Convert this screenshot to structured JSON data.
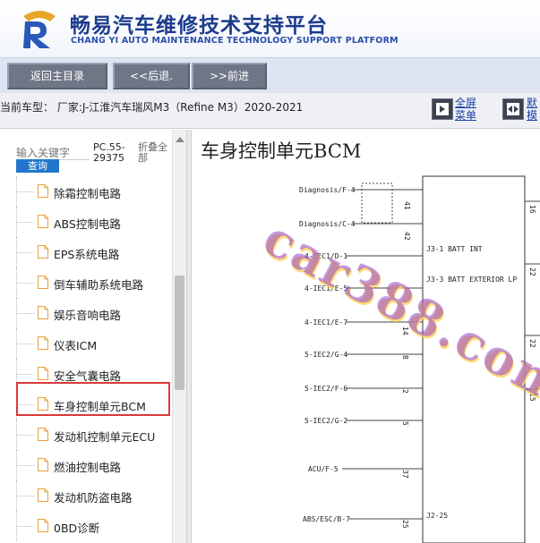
{
  "header": {
    "brand_cn": "畅易汽车维修技术支持平台",
    "brand_en": "CHANG YI AUTO MAINTENANCE TECHNOLOGY SUPPORT PLATFORM"
  },
  "toolbar": {
    "home_label": "返回主目录",
    "back_label": "<<后退.",
    "forward_label": ">>前进"
  },
  "model_bar": {
    "text": "当前车型：  厂家:J-江淮汽车瑞风M3（Refine M3）2020-2021",
    "fullscreen_label": "全屏\n菜单",
    "default_label": "默\n模"
  },
  "search": {
    "placeholder": "输入关键字",
    "button_label": "查询",
    "pc_code": "PC.55-29375",
    "fold_all": "折叠全部"
  },
  "tree": {
    "items": [
      {
        "label": "除霜控制电路"
      },
      {
        "label": "ABS控制电路"
      },
      {
        "label": "EPS系统电路"
      },
      {
        "label": "倒车辅助系统电路"
      },
      {
        "label": "娱乐音响电路"
      },
      {
        "label": "仪表ICM"
      },
      {
        "label": "安全气囊电路"
      },
      {
        "label": "车身控制单元BCM"
      },
      {
        "label": "发动机控制单元ECU"
      },
      {
        "label": "燃油控制电路"
      },
      {
        "label": "发动机防盗电路"
      },
      {
        "label": "0BD诊断"
      }
    ],
    "selected_index": 7
  },
  "content": {
    "title": "车身控制单元BCM",
    "watermark": "car388.com",
    "diagram": {
      "left_labels": [
        {
          "text": "Diagnosis/F-4",
          "pin": "41"
        },
        {
          "text": "Diagnosis/C-4",
          "pin": "42"
        },
        {
          "text": "4-IEC1/D-1",
          "pin": ""
        },
        {
          "text": "4-IEC1/E-5",
          "pin": ""
        },
        {
          "text": "4-IEC1/E-7",
          "pin": "14"
        },
        {
          "text": "5-IEC2/G-4",
          "pin": "8"
        },
        {
          "text": "5-IEC2/F-6",
          "pin": "2"
        },
        {
          "text": "5-IEC2/G-2",
          "pin": "5"
        },
        {
          "text": "ACU/F-5",
          "pin": "37"
        },
        {
          "text": "ABS/ESC/B-7",
          "pin": "25"
        }
      ],
      "inner_labels": [
        {
          "text": "J3-1 BATT INT"
        },
        {
          "text": "J3-3 BATT EXTERIOR LP"
        },
        {
          "text": "J2-25"
        }
      ],
      "right_pins": [
        "16",
        "22",
        "22",
        "15"
      ]
    }
  },
  "colors": {
    "brand_blue": "#1c3c8c",
    "nav_button": "#6f7787",
    "search_button": "#2277cc",
    "selection_border": "#d93a3a"
  }
}
